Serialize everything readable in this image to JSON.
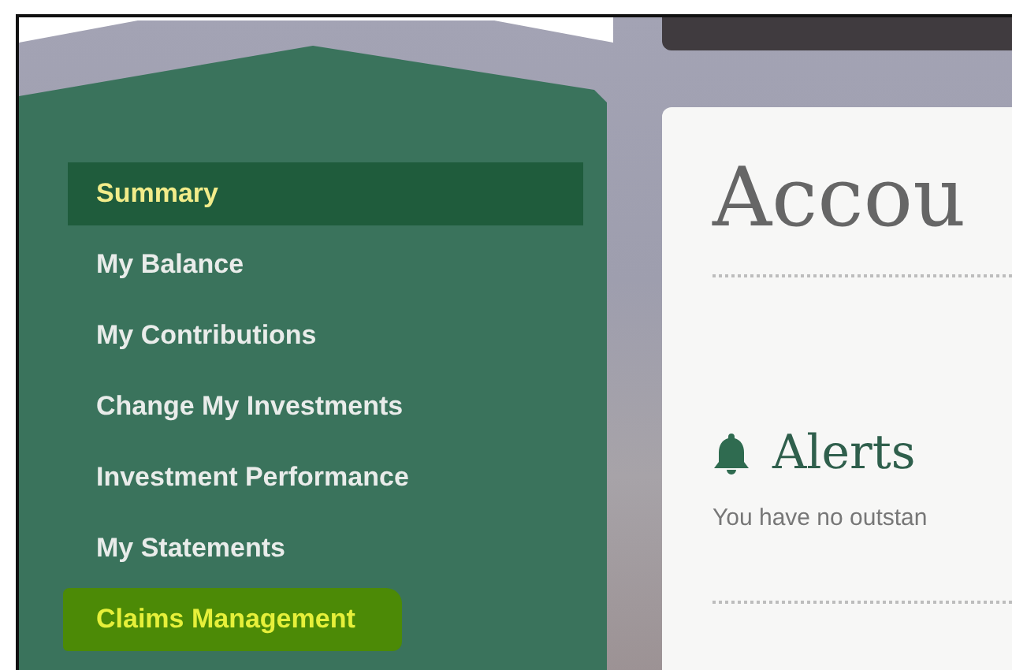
{
  "sidebar": {
    "items": [
      {
        "label": "Summary",
        "selected": true,
        "highlighted": false
      },
      {
        "label": "My Balance",
        "selected": false,
        "highlighted": false
      },
      {
        "label": "My Contributions",
        "selected": false,
        "highlighted": false
      },
      {
        "label": "Change My Investments",
        "selected": false,
        "highlighted": false
      },
      {
        "label": "Investment Performance",
        "selected": false,
        "highlighted": false
      },
      {
        "label": "My Statements",
        "selected": false,
        "highlighted": false
      },
      {
        "label": "Claims Management",
        "selected": false,
        "highlighted": true
      }
    ]
  },
  "main": {
    "title": "Accou",
    "alerts": {
      "heading": "Alerts",
      "message": "You have no outstan"
    }
  }
}
